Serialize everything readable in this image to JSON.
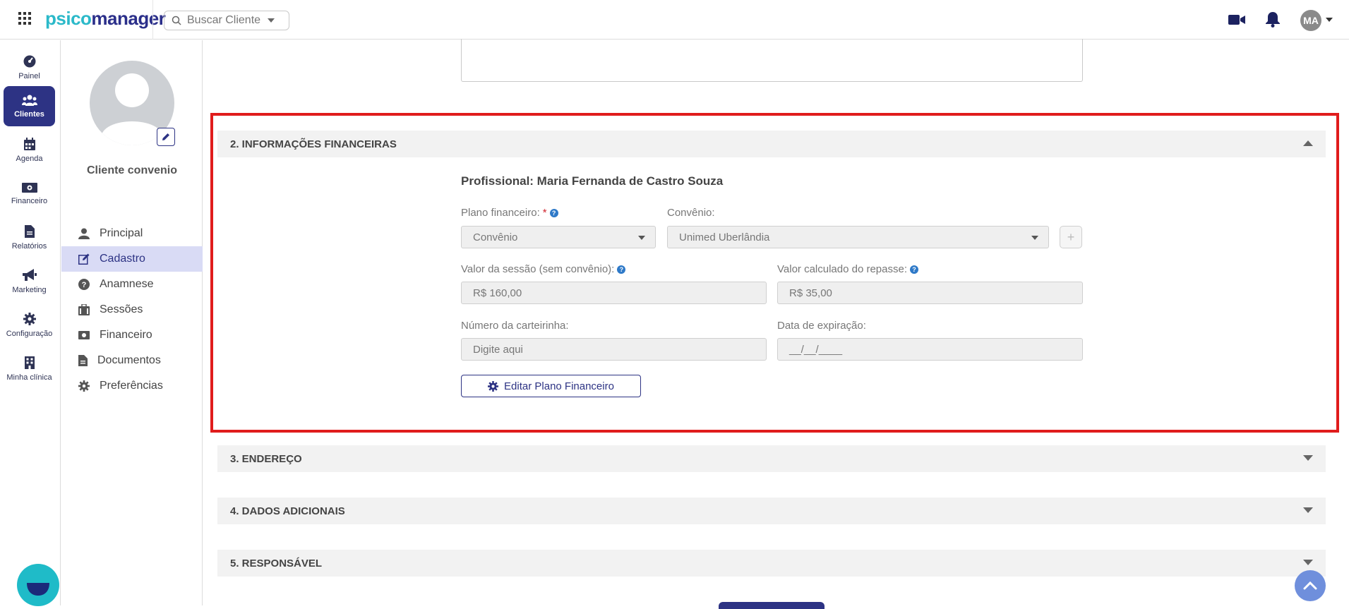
{
  "app": {
    "logo_part1": "psico",
    "logo_part2": "manager"
  },
  "search": {
    "placeholder": "Buscar Cliente"
  },
  "user": {
    "initials": "MA"
  },
  "rail": [
    {
      "label": "Painel",
      "icon": "dashboard-icon"
    },
    {
      "label": "Clientes",
      "icon": "users-icon"
    },
    {
      "label": "Agenda",
      "icon": "calendar-icon"
    },
    {
      "label": "Financeiro",
      "icon": "money-icon"
    },
    {
      "label": "Relatórios",
      "icon": "report-icon"
    },
    {
      "label": "Marketing",
      "icon": "megaphone-icon"
    },
    {
      "label": "Configuração",
      "icon": "gear-icon"
    },
    {
      "label": "Minha clínica",
      "icon": "building-icon"
    }
  ],
  "client": {
    "name": "Cliente convenio"
  },
  "submenu": [
    {
      "label": "Principal",
      "icon": "user-icon"
    },
    {
      "label": "Cadastro",
      "icon": "edit-icon"
    },
    {
      "label": "Anamnese",
      "icon": "question-icon"
    },
    {
      "label": "Sessões",
      "icon": "briefcase-icon"
    },
    {
      "label": "Financeiro",
      "icon": "money-icon"
    },
    {
      "label": "Documentos",
      "icon": "document-icon"
    },
    {
      "label": "Preferências",
      "icon": "gear-icon"
    }
  ],
  "sections": {
    "financial": "2. INFORMAÇÕES FINANCEIRAS",
    "address": "3. ENDEREÇO",
    "additional": "4. DADOS ADICIONAIS",
    "responsible": "5. RESPONSÁVEL"
  },
  "financial": {
    "professional": "Profissional: Maria Fernanda de Castro Souza",
    "plan_label": "Plano financeiro:",
    "plan_required": "*",
    "plan_value": "Convênio",
    "convenio_label": "Convênio:",
    "convenio_value": "Unimed Uberlândia",
    "add_label": "+",
    "session_label": "Valor da sessão (sem convênio):",
    "session_value": "R$ 160,00",
    "repasse_label": "Valor calculado do repasse:",
    "repasse_value": "R$ 35,00",
    "card_label": "Número da carteirinha:",
    "card_placeholder": "Digite aqui",
    "expiry_label": "Data de expiração:",
    "expiry_placeholder": "__/__/____",
    "edit_button": "Editar Plano Financeiro"
  },
  "colors": {
    "brand": "#2d3384",
    "accent": "#2bb9c9",
    "highlight": "#e01c1c",
    "help": "#2e79c8"
  }
}
